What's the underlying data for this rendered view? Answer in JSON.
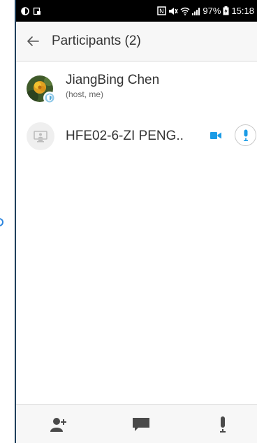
{
  "status_bar": {
    "battery": "97%",
    "time": "15:18"
  },
  "header": {
    "title": "Participants (2)"
  },
  "participants": [
    {
      "name": "JiangBing Chen",
      "role": "(host, me)"
    },
    {
      "name": "HFE02-6-ZI PENG.."
    }
  ],
  "colors": {
    "accent": "#1a9be6",
    "icon_dark": "#4a4a4a"
  },
  "icons": {
    "back": "back-arrow-icon",
    "video": "video-camera-icon",
    "mic": "microphone-icon",
    "invite": "add-person-icon",
    "chat": "chat-icon",
    "mute": "microphone-icon"
  }
}
